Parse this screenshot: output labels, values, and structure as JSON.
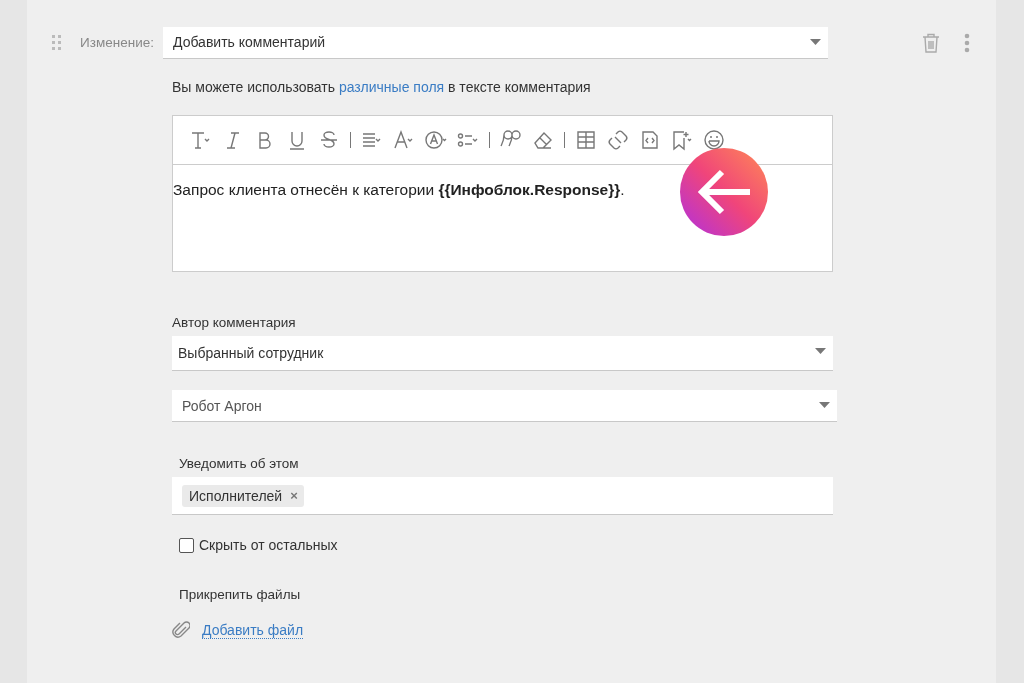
{
  "change": {
    "label": "Изменение:",
    "value": "Добавить комментарий"
  },
  "hint": {
    "before": "Вы можете использовать",
    "link": "различные поля",
    "after": "в тексте комментария"
  },
  "editor": {
    "text": "Запрос клиента отнесён к категории **{{Инфоблок.Response}}**."
  },
  "author": {
    "label": "Автор комментария",
    "type_value": "Выбранный сотрудник",
    "person_value": "Робот Аргон"
  },
  "notify": {
    "label": "Уведомить об этом",
    "tags": [
      {
        "label": "Исполнителей",
        "remove": "×"
      }
    ]
  },
  "hide": {
    "label": "Скрыть от остальных",
    "checked": false
  },
  "attach": {
    "label": "Прикрепить файлы",
    "link": "Добавить файл"
  }
}
